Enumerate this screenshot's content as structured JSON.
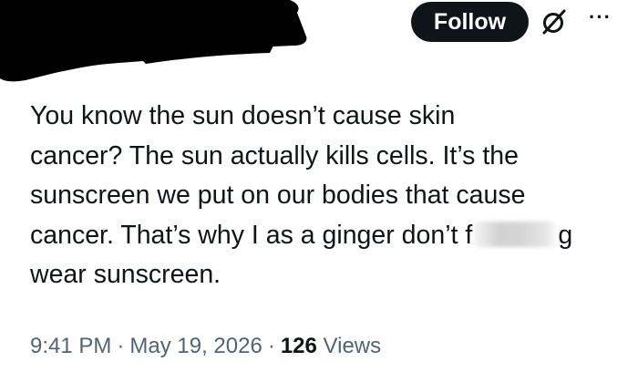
{
  "header": {
    "follow_label": "Follow",
    "grok_icon": "grok-slashed-circle-icon",
    "more_icon": "more-dots-icon",
    "more_glyph": "···"
  },
  "tweet": {
    "lines": [
      "You know the sun doesn’t cause skin",
      "cancer? The sun actually kills cells. It’s the",
      "sunscreen we put on our bodies that cause"
    ],
    "line4_before": "cancer. That’s why I as a ginger don’t f",
    "line4_after": "g",
    "line5": "wear sunscreen."
  },
  "meta": {
    "time": "9:41 PM",
    "separator": "·",
    "date": "May 19, 2026",
    "views_count": "126",
    "views_label": "Views"
  },
  "colors": {
    "primary_text": "#0f1419",
    "secondary_text": "#536471",
    "follow_bg": "#0f1419",
    "follow_text": "#ffffff",
    "redaction": "#000000"
  }
}
